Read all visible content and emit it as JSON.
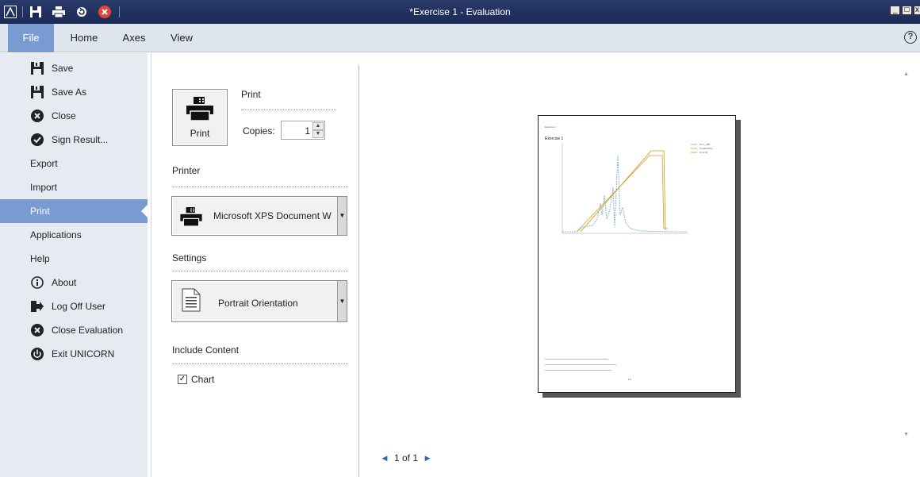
{
  "window": {
    "title": "*Exercise 1 - Evaluation",
    "controls": [
      "minimize",
      "maximize",
      "close"
    ]
  },
  "quick_access": {
    "icons": [
      "app-logo-icon",
      "save-icon",
      "print-icon",
      "undo-icon",
      "close-red-icon"
    ]
  },
  "ribbon": {
    "tabs": [
      {
        "label": "File",
        "active": true
      },
      {
        "label": "Home",
        "active": false
      },
      {
        "label": "Axes",
        "active": false
      },
      {
        "label": "View",
        "active": false
      }
    ],
    "help_label": "?"
  },
  "sidebar": {
    "items": [
      {
        "label": "Save",
        "icon": "save-icon"
      },
      {
        "label": "Save As",
        "icon": "save-as-icon"
      },
      {
        "label": "Close",
        "icon": "close-circle-icon"
      },
      {
        "label": "Sign Result...",
        "icon": "check-circle-icon"
      },
      {
        "label": "Export"
      },
      {
        "label": "Import"
      },
      {
        "label": "Print",
        "selected": true
      },
      {
        "label": "Applications"
      },
      {
        "label": "Help"
      },
      {
        "label": "About",
        "icon": "info-icon"
      },
      {
        "label": "Log Off User",
        "icon": "log-off-icon"
      },
      {
        "label": "Close Evaluation",
        "icon": "close-circle-icon"
      },
      {
        "label": "Exit UNICORN",
        "icon": "power-icon"
      }
    ]
  },
  "print_settings": {
    "print_button_label": "Print",
    "print_heading": "Print",
    "copies_label": "Copies:",
    "copies_value": "1",
    "printer_heading": "Printer",
    "printer_value": "Microsoft XPS Document W",
    "settings_heading": "Settings",
    "orientation_value": "Portrait Orientation",
    "include_heading": "Include Content",
    "chart_checkbox_label": "Chart",
    "chart_checked": true
  },
  "preview": {
    "page_indicator": "1 of 1",
    "page_heading": "Exercise 1",
    "page_number": "1/1",
    "legend": [
      "UV 1_280",
      "Conductivity",
      "Conc B"
    ]
  },
  "colors": {
    "titlebar": "#1b2a55",
    "accent": "#7a9bd1",
    "sidebar_bg": "#e6eaf1",
    "uv_line": "#6fa8dc",
    "cond_line": "#e69138",
    "conc_line": "#b8a000"
  }
}
